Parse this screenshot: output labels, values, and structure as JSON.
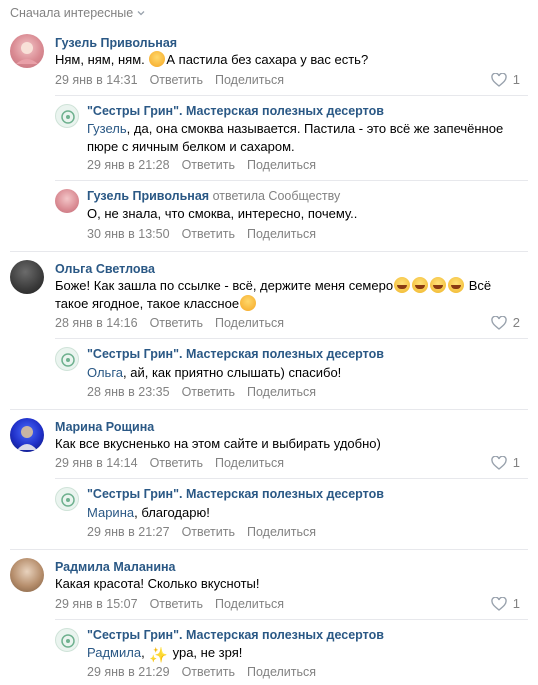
{
  "sort_label": "Сначала интересные",
  "threads": [
    {
      "author": "Гузель Привольная",
      "text_before": "Ням, ням, ням.",
      "text_after": "А пастила без сахара у вас есть?",
      "date": "29 янв в 14:31",
      "reply": "Ответить",
      "share": "Поделиться",
      "likes": "1",
      "replies": [
        {
          "author": "\"Сестры Грин\". Мастерская полезных десертов",
          "mention": "Гузель",
          "text": ", да, она смоква называется. Пастила - это всё же запечённое",
          "text2": "пюре с яичным белком и сахаром.",
          "date": "29 янв в 21:28",
          "reply": "Ответить",
          "share": "Поделиться"
        },
        {
          "author": "Гузель Привольная",
          "reply_to": "ответила Сообществу",
          "text": "О, не знала, что смоква, интересно, почему..",
          "date": "30 янв в 13:50",
          "reply": "Ответить",
          "share": "Поделиться"
        }
      ]
    },
    {
      "author": "Ольга Светлова",
      "text": "Боже! Как зашла по ссылке - всё, держите меня семеро",
      "text_tail": " Всё",
      "text2": "такое ягодное, такое классное",
      "date": "28 янв в 14:16",
      "reply": "Ответить",
      "share": "Поделиться",
      "likes": "2",
      "replies": [
        {
          "author": "\"Сестры Грин\". Мастерская полезных десертов",
          "mention": "Ольга",
          "text": ", ай, как приятно слышать) спасибо!",
          "date": "28 янв в 23:35",
          "reply": "Ответить",
          "share": "Поделиться"
        }
      ]
    },
    {
      "author": "Марина Рощина",
      "text": "Как все вкусненько на этом сайте и выбирать удобно)",
      "date": "29 янв в 14:14",
      "reply": "Ответить",
      "share": "Поделиться",
      "likes": "1",
      "replies": [
        {
          "author": "\"Сестры Грин\". Мастерская полезных десертов",
          "mention": "Марина",
          "text": ", благодарю!",
          "date": "29 янв в 21:27",
          "reply": "Ответить",
          "share": "Поделиться"
        }
      ]
    },
    {
      "author": "Радмила Маланина",
      "text": "Какая красота! Сколько вкусноты!",
      "date": "29 янв в 15:07",
      "reply": "Ответить",
      "share": "Поделиться",
      "likes": "1",
      "replies": [
        {
          "author": "\"Сестры Грин\". Мастерская полезных десертов",
          "mention": "Радмила",
          "text": " ура, не зря!",
          "date": "29 янв в 21:29",
          "reply": "Ответить",
          "share": "Поделиться"
        }
      ]
    }
  ],
  "icons": {
    "like": "heart-icon",
    "sort": "chevron-down-icon"
  },
  "colors": {
    "link": "#2a5885",
    "muted": "#828282",
    "divider": "#e7e8ec"
  }
}
